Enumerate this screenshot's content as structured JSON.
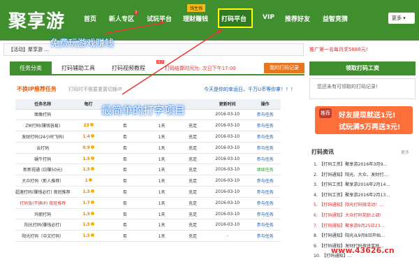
{
  "header": {
    "logo": "聚享游",
    "nav": [
      "首页",
      "新人专区",
      "试玩平台",
      "理财赚钱",
      "打码平台",
      "VIP",
      "推荐好友",
      "益智竞猜"
    ],
    "badge": "钱生钱",
    "dot": "1",
    "more": "更多 ▾"
  },
  "notice": "【活动】聚享游 ...",
  "promo": "推广第一名每月奖5888元!",
  "tabs": {
    "a": "任务分类",
    "b": "打码辅助工具",
    "c": "打码视频教程",
    "d": "打码结算时间为: 次日下午17:00",
    "btn": "我的打码记录",
    "new": "NEW"
  },
  "section": {
    "title": "不换IP推荐任务",
    "sub": "打码时不需要重置切换IP",
    "right": "今天是你的幸运日，千万U币等你拿！！！"
  },
  "table": {
    "headers": [
      "任务名称",
      "每打",
      "",
      "",
      "",
      "更新时间",
      "操作"
    ],
    "rows": [
      [
        "图像打码",
        "",
        "",
        "",
        "",
        "2016-03-10",
        "参与任务"
      ],
      [
        "ZM打码(赚钱容易)",
        "23",
        "否",
        "1天",
        "充足",
        "2016-03-10",
        "参与任务"
      ],
      [
        "发财打码(24小时飞码)",
        "1.4",
        "否",
        "1天",
        "充足",
        "2016-03-10",
        "参与任务"
      ],
      [
        "云打码",
        "0.9",
        "否",
        "1天",
        "充足",
        "2016-03-10",
        "参与任务"
      ],
      [
        "蜗牛打码",
        "1.5",
        "否",
        "1天",
        "充足",
        "2016-03-10",
        "参与任务"
      ],
      [
        "新新视通 (日赚50元)",
        "1.5",
        "否",
        "1天",
        "充足",
        "2016-03-10",
        "继续任务"
      ],
      [
        "大众打码（新人推荐）",
        "1",
        "否",
        "1天",
        "充足",
        "2016-03-10",
        "参与任务"
      ],
      [
        "超速打码(赚钱必打) 夜班推荐",
        "1.5",
        "否",
        "1天",
        "充足",
        "2016-03-10",
        "参与任务"
      ],
      [
        "打码兔(不换IP) 夜班推荐",
        "1.7",
        "否",
        "1天",
        "充足",
        "2016-03-10",
        "参与任务"
      ],
      [
        "玛丽打码",
        "1.5",
        "否",
        "1天",
        "充足",
        "2016-03-10",
        "参与任务"
      ],
      [
        "阳光打码(赚钱必打)",
        "1.5",
        "否",
        "1天",
        "充足",
        "2016-03-10",
        "参与任务"
      ],
      [
        "阳光打码（中文打码）",
        "1.5",
        "否",
        "1天",
        "充足",
        "-",
        "参与任务"
      ]
    ]
  },
  "side": {
    "header": "领取打码工资",
    "text": "您还未有可领取的打码记录!",
    "banner_tag": "推荐",
    "banner_l1": "好友提现就送1元!",
    "banner_l2": "试玩满5万再送3元!",
    "news_title": "打码资讯",
    "news_more": "更多",
    "news": [
      "1. 【打码工资】聚享游2016年3月9...",
      "2. 【打码通知】阳光、大众、发财打...",
      "3. 【打码工资】聚享游2016年2月14...",
      "4. 【打码工资】聚享游2016年2月13...",
      "5. 【打码通知】阳光打码微活动！...",
      "6. 【打码通知】大众打码奖励上调!",
      "7. 【打码通知】聚享游9月25日23...",
      "8. 【打码通知】阳光从9月8日开始...",
      "9. 【打码通知】发财打码夜班奖励...",
      "10. 【打码通知】..."
    ]
  },
  "overlay": {
    "a": "免费玩游戏赚钱",
    "b": "最简单的打字项目"
  },
  "watermark": "www.43626.cn"
}
